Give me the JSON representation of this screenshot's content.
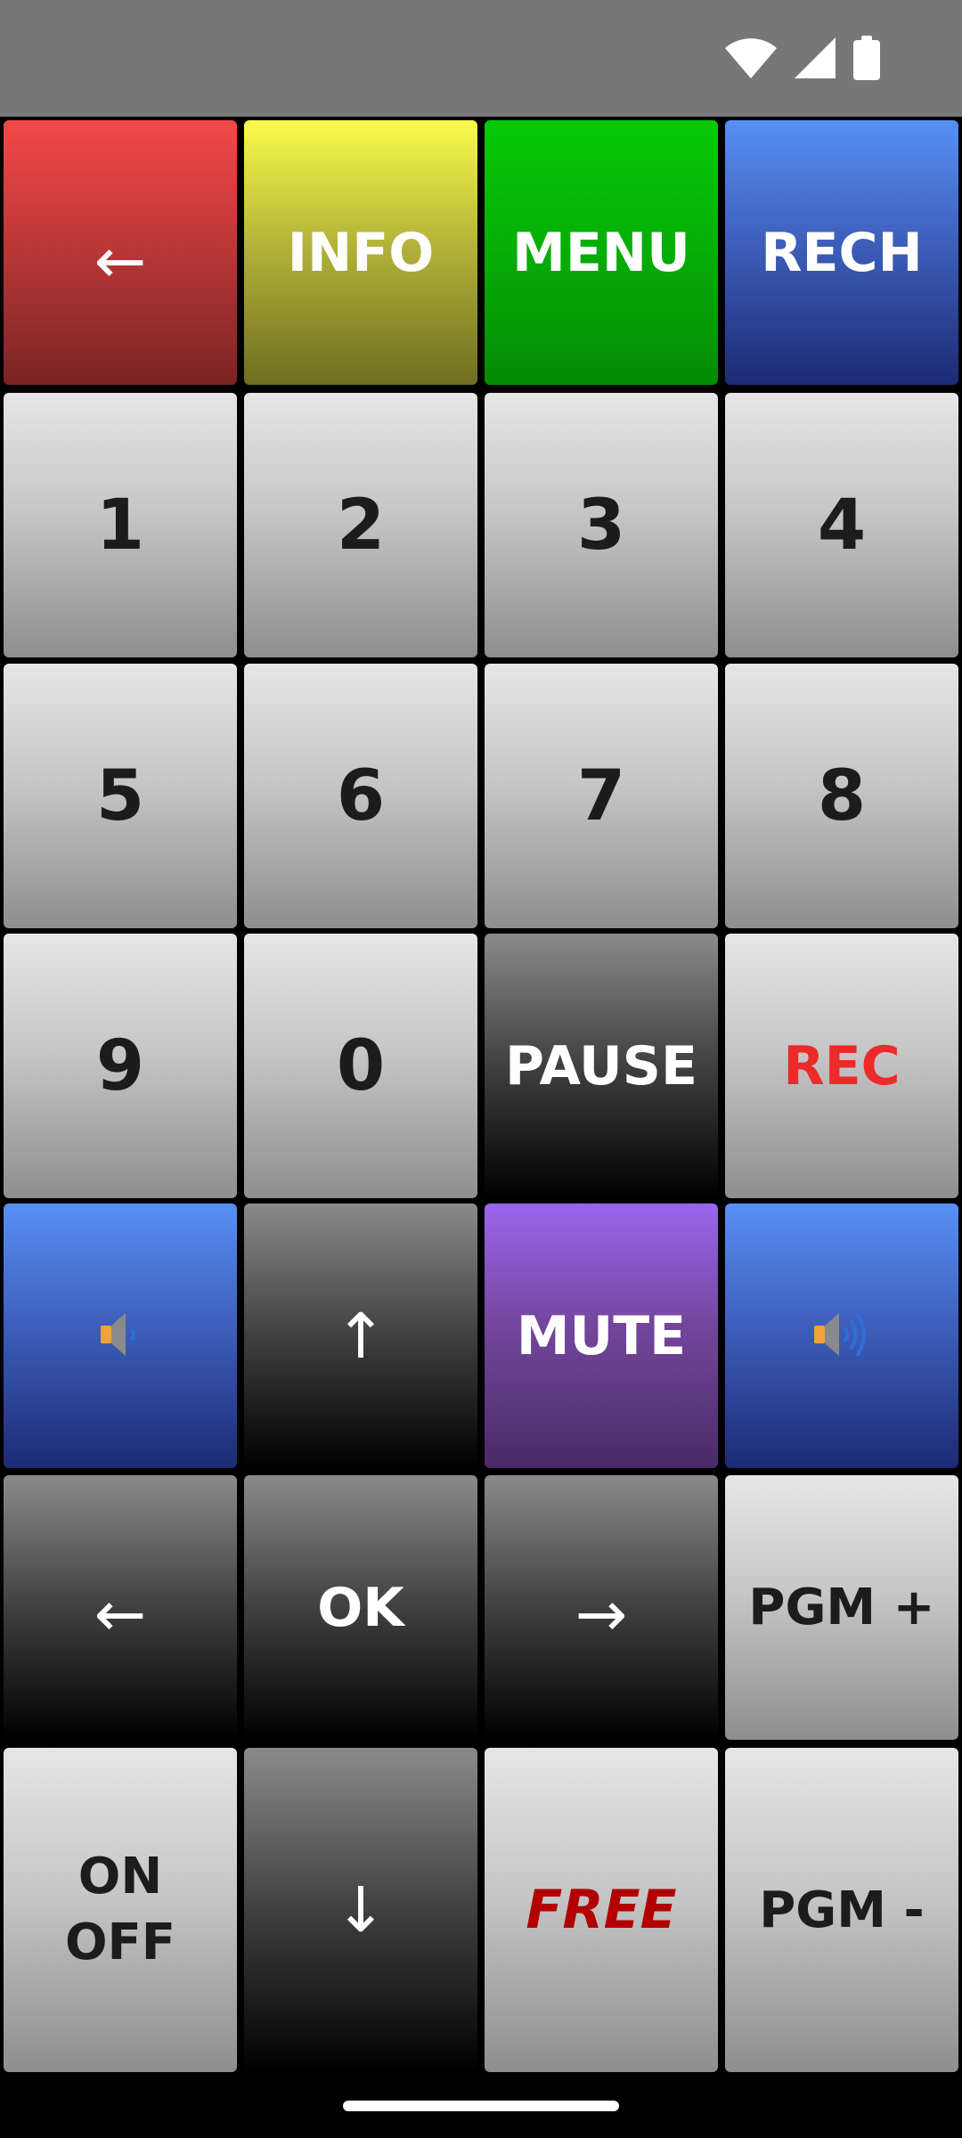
{
  "status_bar": {
    "background": "#777777",
    "icons": [
      "wifi-icon",
      "cellular-signal-icon",
      "battery-icon"
    ]
  },
  "keys": {
    "back_top": {
      "label": "←",
      "color": "#f44848"
    },
    "info": {
      "label": "INFO",
      "color": "#fbfb4c"
    },
    "menu": {
      "label": "MENU",
      "color": "#07c907"
    },
    "rech": {
      "label": "RECH",
      "color": "#5890f4"
    },
    "digit_1": {
      "label": "1"
    },
    "digit_2": {
      "label": "2"
    },
    "digit_3": {
      "label": "3"
    },
    "digit_4": {
      "label": "4"
    },
    "digit_5": {
      "label": "5"
    },
    "digit_6": {
      "label": "6"
    },
    "digit_7": {
      "label": "7"
    },
    "digit_8": {
      "label": "8"
    },
    "digit_9": {
      "label": "9"
    },
    "digit_0": {
      "label": "0"
    },
    "pause": {
      "label": "PAUSE"
    },
    "rec": {
      "label": "REC",
      "color": "#ec2a2a"
    },
    "vol_down": {
      "icon": "volume-low-icon"
    },
    "up": {
      "label": "↑"
    },
    "mute": {
      "label": "MUTE",
      "color": "#9a66ee"
    },
    "vol_up": {
      "icon": "volume-high-icon"
    },
    "left": {
      "label": "←"
    },
    "ok": {
      "label": "OK"
    },
    "right": {
      "label": "→"
    },
    "pgm_plus": {
      "label": "PGM +"
    },
    "on": {
      "label": "ON"
    },
    "off": {
      "label": "OFF"
    },
    "down": {
      "label": "↓"
    },
    "free": {
      "label": "FREE",
      "color": "#b20000"
    },
    "pgm_minus": {
      "label": "PGM -"
    }
  }
}
